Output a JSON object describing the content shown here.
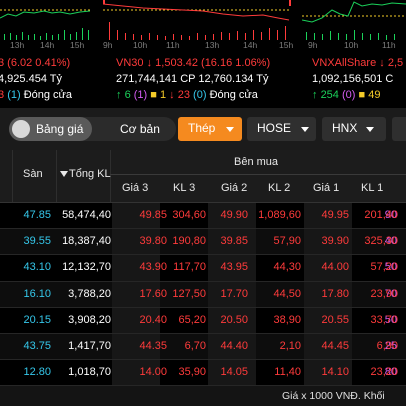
{
  "indices": [
    {
      "name": "",
      "line1_value": "",
      "line1_change": "3 (6.02 0.41%)",
      "line2": "4,925.454 Tỷ",
      "line3_up": "",
      "line3_ref": "",
      "line3_down": "3",
      "line3_floor": "(1)",
      "line3_status": "Đóng cửa",
      "ticks": [
        "13h",
        "14h",
        "15h"
      ]
    },
    {
      "name": "VN30",
      "line1_change": "1,503.42 (16.16 1.06%)",
      "line2_volume": "271,744,141",
      "line2_value": "CP 12,760.134 Tỷ",
      "line3_up": "6",
      "line3_ceil": "(1)",
      "line3_ref": "1",
      "line3_down": "23",
      "line3_floor": "(0)",
      "line3_status": "Đóng cửa",
      "ticks": [
        "9h",
        "10h",
        "11h",
        "13h",
        "14h",
        "15h"
      ]
    },
    {
      "name": "VNXAllShare",
      "line1_change": "2,5",
      "line2_volume": "1,092,156,501",
      "line2_value": "C",
      "line3_up": "254",
      "line3_ceil": "(0)",
      "line3_ref": "49",
      "ticks": [
        "9h",
        "10h",
        "11h"
      ]
    }
  ],
  "toolbar": {
    "bang_gia": "Bảng giá",
    "co_ban": "Cơ bản",
    "thep": "Thép",
    "hose": "HOSE",
    "hnx": "HNX"
  },
  "table": {
    "group_title": "Bên mua",
    "headers": {
      "san": "Sàn",
      "tong_kl": "Tổng KL",
      "gia3": "Giá 3",
      "kl3": "KL 3",
      "gia2": "Giá 2",
      "kl2": "KL 2",
      "gia1": "Giá 1",
      "kl1": "KL 1"
    },
    "rows": [
      {
        "tran": "90",
        "san": "47.85",
        "tong": "58,474,40",
        "g3": "49.85",
        "k3": "304,60",
        "g2": "49.90",
        "k2": "1,089,60",
        "g1": "49.95",
        "k1": "201,40"
      },
      {
        "tran": "40",
        "san": "39.55",
        "tong": "18,387,40",
        "g3": "39.80",
        "k3": "190,80",
        "g2": "39.85",
        "k2": "57,90",
        "g1": "39.90",
        "k1": "325,30"
      },
      {
        "tran": "50",
        "san": "43.10",
        "tong": "12,132,70",
        "g3": "43.90",
        "k3": "117,70",
        "g2": "43.95",
        "k2": "44,30",
        "g1": "44.00",
        "k1": "57,20"
      },
      {
        "tran": "70",
        "san": "16.10",
        "tong": "3,788,20",
        "g3": "17.60",
        "k3": "127,50",
        "g2": "17.70",
        "k2": "44,50",
        "g1": "17.80",
        "k1": "23,90"
      },
      {
        "tran": "50",
        "san": "20.15",
        "tong": "3,908,20",
        "g3": "20.40",
        "k3": "65,20",
        "g2": "20.50",
        "k2": "38,90",
        "g1": "20.55",
        "k1": "33,70"
      },
      {
        "tran": "25",
        "san": "43.75",
        "tong": "1,417,70",
        "g3": "44.35",
        "k3": "6,70",
        "g2": "44.40",
        "k2": "2,10",
        "g1": "44.45",
        "k1": "6,90"
      },
      {
        "tran": "80",
        "san": "12.80",
        "tong": "1,018,70",
        "g3": "14.00",
        "k3": "35,90",
        "g2": "14.05",
        "k2": "11,40",
        "g1": "14.10",
        "k1": "23,20"
      }
    ]
  },
  "footer": "Giá x 1000 VNĐ. Khối",
  "colors": {
    "up": "#1bd15a",
    "down": "#ff3b3b",
    "ref": "#f5cc29",
    "ceiling": "#d45df2",
    "floor": "#35c7ea",
    "accent": "#f58a1f"
  }
}
